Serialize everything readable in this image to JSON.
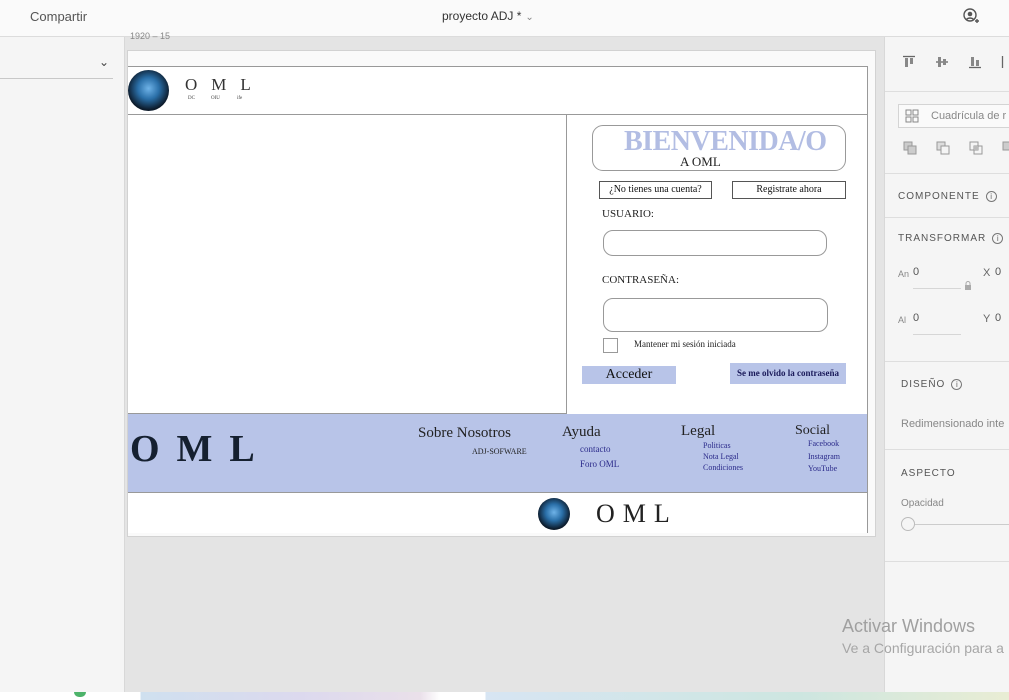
{
  "topbar": {
    "share_label": "Compartir",
    "project_title": "proyecto ADJ *",
    "icons": {
      "user": "user-account-icon",
      "dropdown": "chevron-down-icon"
    }
  },
  "canvas": {
    "artboard_label": "1920 – 15"
  },
  "design": {
    "brand": "OML",
    "header_sub": [
      "DC",
      "OIU",
      "ife"
    ],
    "welcome_title": "BIENVENIDA/O",
    "welcome_subtitle": "A OML",
    "no_account": "¿No tienes una cuenta?",
    "register": "Registrate ahora",
    "user_label": "USUARIO:",
    "password_label": "CONTRASEÑA:",
    "keep_session": "Mantener mi sesión iniciada",
    "login_button": "Acceder",
    "forgot_password": "Se me olvido la contraseña",
    "footer": {
      "about": {
        "title": "Sobre Nosotros",
        "links": [
          "ADJ-SOFWARE"
        ]
      },
      "help": {
        "title": "Ayuda",
        "links": [
          "contacto",
          "Foro OML"
        ]
      },
      "legal": {
        "title": "Legal",
        "links": [
          "Politicas",
          "Nota Legal",
          "Condiciones"
        ]
      },
      "social": {
        "title": "Social",
        "links": [
          "Facebook",
          "Instagram",
          "YouTube"
        ]
      }
    },
    "colors": {
      "accent": "#b8c4e8",
      "welcome_text": "#b2bde3",
      "link": "#2a2a8a"
    }
  },
  "inspector": {
    "grid_search": "Cuadrícula de r",
    "component": "COMPONENTE",
    "transform": "TRANSFORMAR",
    "width_label": "An",
    "width_value": "0",
    "height_label": "Al",
    "height_value": "0",
    "x_label": "X",
    "x_value": "0",
    "y_label": "Y",
    "y_value": "0",
    "layout": "DISEÑO",
    "resize": "Redimensionado inte",
    "appearance": "ASPECTO",
    "opacity": "Opacidad"
  },
  "watermark": {
    "line1": "Activar Windows",
    "line2": "Ve a Configuración para a"
  }
}
